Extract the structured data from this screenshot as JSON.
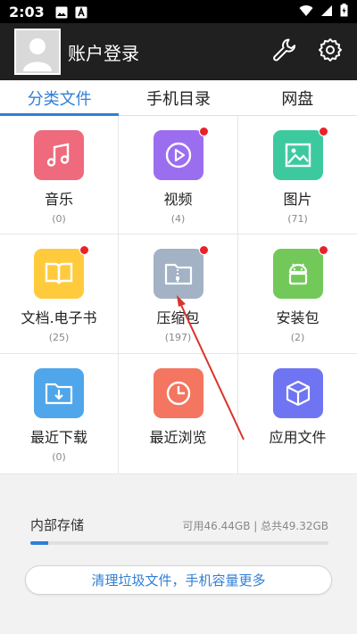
{
  "status_bar": {
    "time": "2:03"
  },
  "header": {
    "title": "账户登录"
  },
  "tabs": [
    {
      "label": "分类文件",
      "active": true
    },
    {
      "label": "手机目录",
      "active": false
    },
    {
      "label": "网盘",
      "active": false
    }
  ],
  "categories": [
    {
      "label": "音乐",
      "count": "(0)",
      "color": "#ee6a7c",
      "badge": false
    },
    {
      "label": "视频",
      "count": "(4)",
      "color": "#9b6ef0",
      "badge": true
    },
    {
      "label": "图片",
      "count": "(71)",
      "color": "#3dc99e",
      "badge": true
    },
    {
      "label": "文档.电子书",
      "count": "(25)",
      "color": "#ffcb3d",
      "badge": true
    },
    {
      "label": "压缩包",
      "count": "(197)",
      "color": "#a3b2c5",
      "badge": true
    },
    {
      "label": "安装包",
      "count": "(2)",
      "color": "#72c95a",
      "badge": true
    },
    {
      "label": "最近下载",
      "count": "(0)",
      "color": "#4fa6ea",
      "badge": false
    },
    {
      "label": "最近浏览",
      "count": "",
      "color": "#f47560",
      "badge": false
    },
    {
      "label": "应用文件",
      "count": "",
      "color": "#6f74f2",
      "badge": false
    }
  ],
  "storage": {
    "name": "内部存储",
    "info": "可用46.44GB | 总共49.32GB",
    "used_fraction": 0.06
  },
  "clean_button": {
    "label": "清理垃圾文件，手机容量更多"
  },
  "colors": {
    "accent": "#2f7fd6",
    "badge": "#e8222a",
    "header_bg": "#202020"
  }
}
